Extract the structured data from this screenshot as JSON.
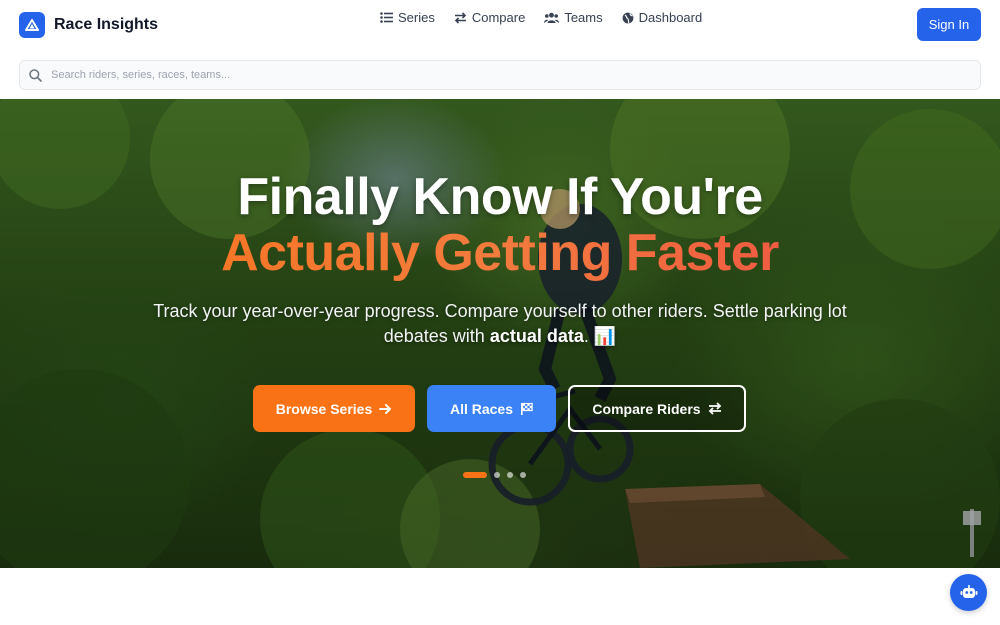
{
  "brand": {
    "name": "Race Insights"
  },
  "nav": {
    "items": [
      {
        "label": "Series",
        "icon": "list-icon"
      },
      {
        "label": "Compare",
        "icon": "arrows-exchange-icon"
      },
      {
        "label": "Teams",
        "icon": "users-icon"
      },
      {
        "label": "Dashboard",
        "icon": "globe-icon"
      }
    ],
    "signin_label": "Sign In"
  },
  "search": {
    "placeholder": "Search riders, series, races, teams..."
  },
  "hero": {
    "title_line1": "Finally Know If You're",
    "title_line2": "Actually Getting Faster",
    "subtitle_part1": "Track your year-over-year progress. Compare yourself to other riders. Settle parking lot debates with",
    "subtitle_bold": "actual data",
    "subtitle_end": ". 📊",
    "buttons": {
      "browse": "Browse Series",
      "races": "All Races",
      "compare": "Compare Riders"
    },
    "carousel": {
      "slides": 4,
      "active": 1
    }
  },
  "colors": {
    "primary": "#2563eb",
    "accent_orange": "#f97316",
    "accent_red": "#ef4444",
    "button_blue": "#3b82f6"
  }
}
